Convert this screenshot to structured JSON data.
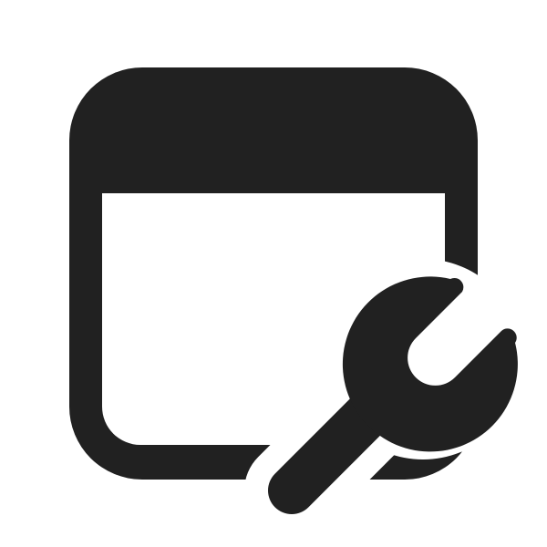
{
  "icon": {
    "name": "app-settings-icon",
    "parts": [
      "window-icon",
      "wrench-icon"
    ],
    "color": "#212121",
    "background": "#ffffff"
  }
}
